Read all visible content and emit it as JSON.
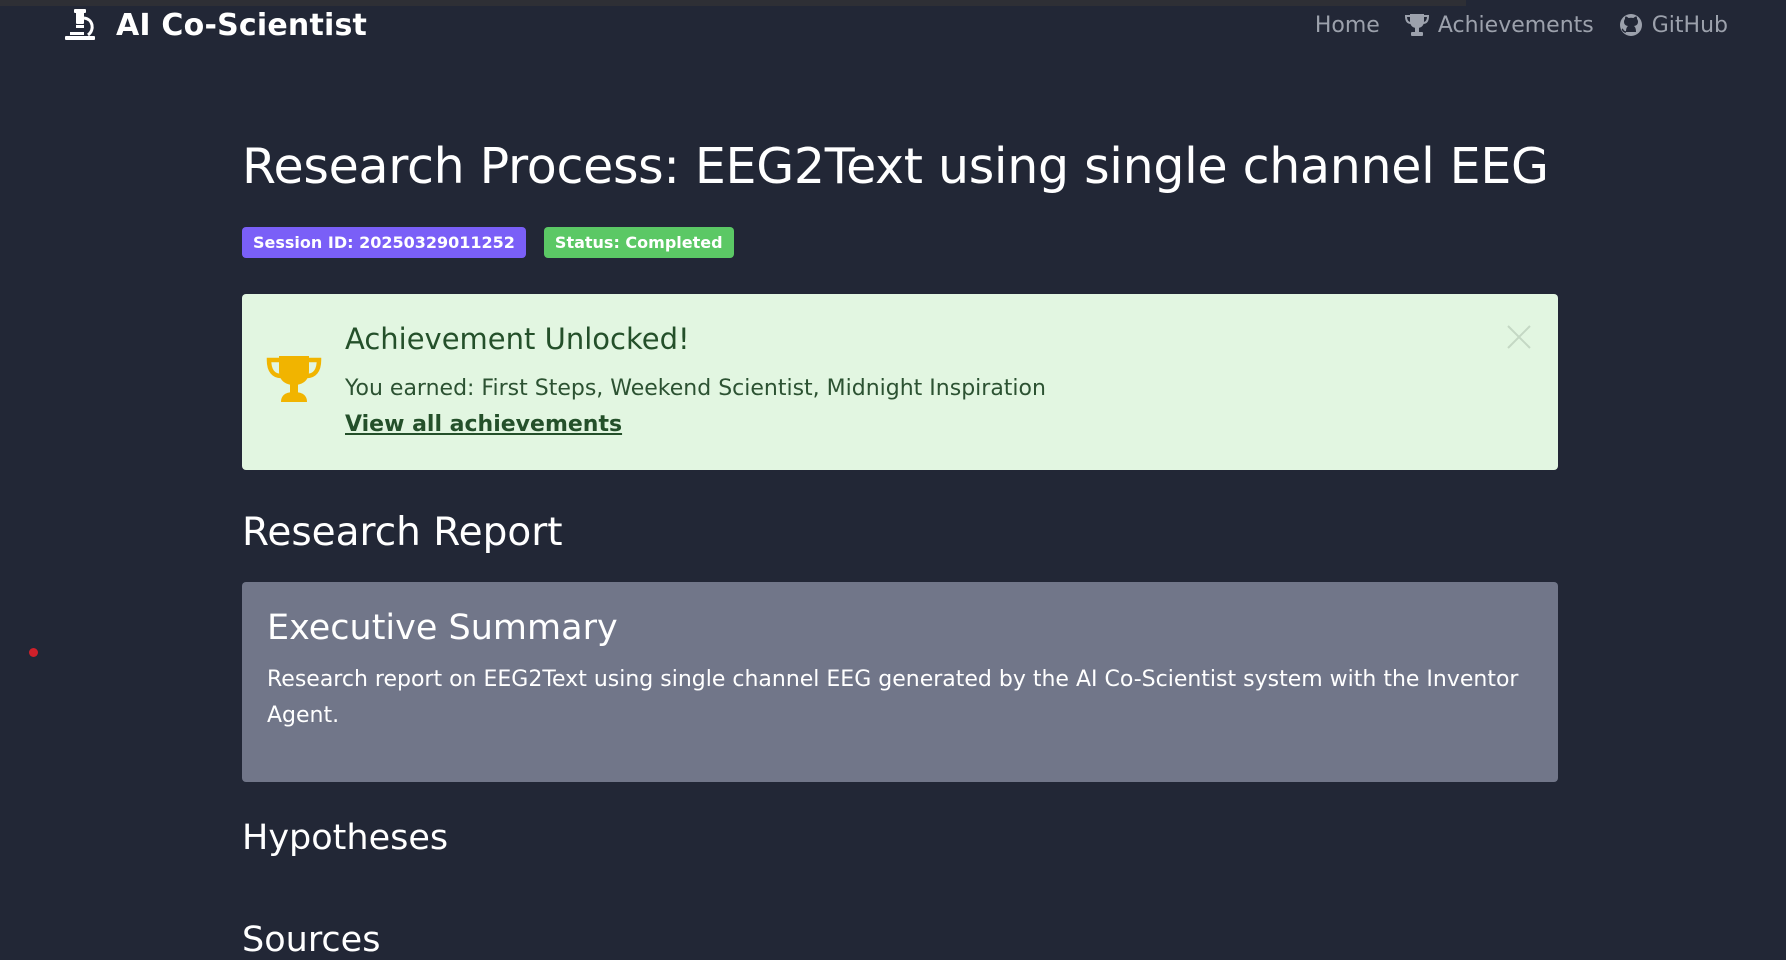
{
  "app": {
    "brand": "AI Co-Scientist",
    "brand_icon": "microscope-icon"
  },
  "nav": {
    "home": "Home",
    "achievements": "Achievements",
    "github": "GitHub"
  },
  "page": {
    "title": "Research Process: EEG2Text using single channel EEG",
    "session_badge": "Session ID: 20250329011252",
    "status_badge": "Status: Completed"
  },
  "alert": {
    "title": "Achievement Unlocked!",
    "text": "You earned: First Steps, Weekend Scientist, Midnight Inspiration",
    "link": "View all achievements"
  },
  "report": {
    "heading": "Research Report",
    "summary_title": "Executive Summary",
    "summary_text": "Research report on EEG2Text using single channel EEG generated by the AI Co-Scientist system with the Inventor Agent.",
    "hypotheses_heading": "Hypotheses",
    "sources_heading": "Sources"
  },
  "colors": {
    "background": "#222736",
    "session_badge": "#7a5ff7",
    "status_badge": "#5bc865",
    "alert_bg": "#e2f6e1",
    "trophy": "#f1b400",
    "summary_card": "#717689"
  }
}
